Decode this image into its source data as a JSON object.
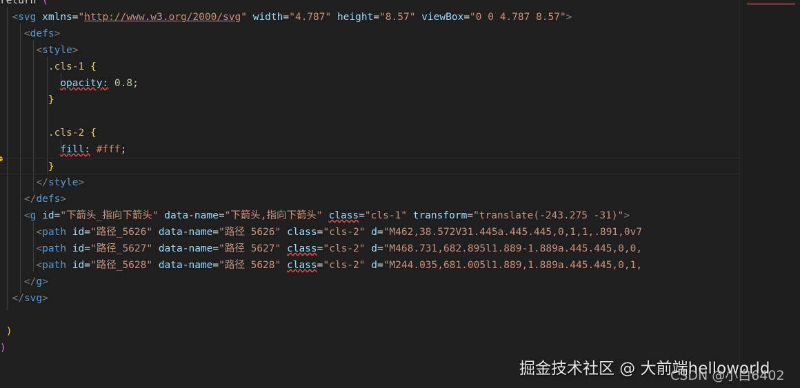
{
  "editor": {
    "lines": [
      [
        [
          "t-txt",
          "return "
        ],
        [
          "t-paren",
          "("
        ]
      ],
      [
        [
          "t-txt",
          "  "
        ],
        [
          "t-br",
          "<"
        ],
        [
          "t-tag",
          "svg"
        ],
        [
          "t-txt",
          " "
        ],
        [
          "t-attr",
          "xmlns"
        ],
        [
          "t-txt",
          "="
        ],
        [
          "t-str",
          "\""
        ],
        [
          "t-url",
          "http://www.w3.org/2000/svg"
        ],
        [
          "t-str",
          "\""
        ],
        [
          "t-txt",
          " "
        ],
        [
          "t-attr",
          "width"
        ],
        [
          "t-txt",
          "="
        ],
        [
          "t-str",
          "\"4.787\""
        ],
        [
          "t-txt",
          " "
        ],
        [
          "t-attr",
          "height"
        ],
        [
          "t-txt",
          "="
        ],
        [
          "t-str",
          "\"8.57\""
        ],
        [
          "t-txt",
          " "
        ],
        [
          "t-attr",
          "viewBox"
        ],
        [
          "t-txt",
          "="
        ],
        [
          "t-str",
          "\"0 0 4.787 8.57\""
        ],
        [
          "t-br",
          ">"
        ]
      ],
      [
        [
          "t-txt",
          "    "
        ],
        [
          "t-br",
          "<"
        ],
        [
          "t-tag",
          "defs"
        ],
        [
          "t-br",
          ">"
        ]
      ],
      [
        [
          "t-txt",
          "      "
        ],
        [
          "t-br",
          "<"
        ],
        [
          "t-tag",
          "style"
        ],
        [
          "t-br",
          ">"
        ]
      ],
      [
        [
          "t-txt",
          "        "
        ],
        [
          "t-sel",
          ".cls-1"
        ],
        [
          "t-txt",
          " "
        ],
        [
          "t-brace",
          "{"
        ]
      ],
      [
        [
          "t-txt",
          "          "
        ],
        [
          "t-prop",
          "opacity:"
        ],
        [
          "t-txt",
          " "
        ],
        [
          "t-num",
          "0.8"
        ],
        [
          "t-txt",
          ";"
        ]
      ],
      [
        [
          "t-txt",
          "        "
        ],
        [
          "t-brace",
          "}"
        ]
      ],
      [
        [
          "t-txt",
          ""
        ]
      ],
      [
        [
          "t-txt",
          "        "
        ],
        [
          "t-sel",
          ".cls-2"
        ],
        [
          "t-txt",
          " "
        ],
        [
          "t-brace",
          "{"
        ]
      ],
      [
        [
          "t-txt",
          "          "
        ],
        [
          "t-prop",
          "fill:"
        ],
        [
          "t-txt",
          " "
        ],
        [
          "t-str",
          "#fff"
        ],
        [
          "t-txt",
          ";"
        ]
      ],
      [
        [
          "t-txt",
          "        "
        ],
        [
          "t-brace",
          "}"
        ]
      ],
      [
        [
          "t-txt",
          "      "
        ],
        [
          "t-br",
          "</"
        ],
        [
          "t-tag",
          "style"
        ],
        [
          "t-br",
          ">"
        ]
      ],
      [
        [
          "t-txt",
          "    "
        ],
        [
          "t-br",
          "</"
        ],
        [
          "t-tag",
          "defs"
        ],
        [
          "t-br",
          ">"
        ]
      ],
      [
        [
          "t-txt",
          "    "
        ],
        [
          "t-br",
          "<"
        ],
        [
          "t-tag",
          "g"
        ],
        [
          "t-txt",
          " "
        ],
        [
          "t-attr",
          "id"
        ],
        [
          "t-txt",
          "="
        ],
        [
          "t-str",
          "\"下箭头_指向下箭头\""
        ],
        [
          "t-txt",
          " "
        ],
        [
          "t-attr",
          "data-name"
        ],
        [
          "t-txt",
          "="
        ],
        [
          "t-str",
          "\"下箭头,指向下箭头\""
        ],
        [
          "t-txt",
          " "
        ],
        [
          "t-attr t-err",
          "class"
        ],
        [
          "t-txt",
          "="
        ],
        [
          "t-str",
          "\"cls-1\""
        ],
        [
          "t-txt",
          " "
        ],
        [
          "t-attr",
          "transform"
        ],
        [
          "t-txt",
          "="
        ],
        [
          "t-str",
          "\"translate(-243.275 -31)\""
        ],
        [
          "t-br",
          ">"
        ]
      ],
      [
        [
          "t-txt",
          "      "
        ],
        [
          "t-br",
          "<"
        ],
        [
          "t-tag",
          "path"
        ],
        [
          "t-txt",
          " "
        ],
        [
          "t-attr",
          "id"
        ],
        [
          "t-txt",
          "="
        ],
        [
          "t-str",
          "\"路径_5626\""
        ],
        [
          "t-txt",
          " "
        ],
        [
          "t-attr",
          "data-name"
        ],
        [
          "t-txt",
          "="
        ],
        [
          "t-str",
          "\"路径 5626\""
        ],
        [
          "t-txt",
          " "
        ],
        [
          "t-attr",
          "class"
        ],
        [
          "t-txt",
          "="
        ],
        [
          "t-str",
          "\"cls-2\""
        ],
        [
          "t-txt",
          " "
        ],
        [
          "t-attr",
          "d"
        ],
        [
          "t-txt",
          "="
        ],
        [
          "t-str",
          "\"M462,38.572V31.445a.445.445,0,1,1,.891,0v7"
        ]
      ],
      [
        [
          "t-txt",
          "      "
        ],
        [
          "t-br",
          "<"
        ],
        [
          "t-tag",
          "path"
        ],
        [
          "t-txt",
          " "
        ],
        [
          "t-attr",
          "id"
        ],
        [
          "t-txt",
          "="
        ],
        [
          "t-str",
          "\"路径_5627\""
        ],
        [
          "t-txt",
          " "
        ],
        [
          "t-attr",
          "data-name"
        ],
        [
          "t-txt",
          "="
        ],
        [
          "t-str",
          "\"路径 5627\""
        ],
        [
          "t-txt",
          " "
        ],
        [
          "t-attr t-err",
          "class"
        ],
        [
          "t-txt",
          "="
        ],
        [
          "t-str",
          "\"cls-2\""
        ],
        [
          "t-txt",
          " "
        ],
        [
          "t-attr",
          "d"
        ],
        [
          "t-txt",
          "="
        ],
        [
          "t-str",
          "\"M468.731,682.895l1.889-1.889a.445.445,0,0,"
        ]
      ],
      [
        [
          "t-txt",
          "      "
        ],
        [
          "t-br",
          "<"
        ],
        [
          "t-tag",
          "path"
        ],
        [
          "t-txt",
          " "
        ],
        [
          "t-attr",
          "id"
        ],
        [
          "t-txt",
          "="
        ],
        [
          "t-str",
          "\"路径_5628\""
        ],
        [
          "t-txt",
          " "
        ],
        [
          "t-attr",
          "data-name"
        ],
        [
          "t-txt",
          "="
        ],
        [
          "t-str",
          "\"路径 5628\""
        ],
        [
          "t-txt",
          " "
        ],
        [
          "t-attr t-err",
          "class"
        ],
        [
          "t-txt",
          "="
        ],
        [
          "t-str",
          "\"cls-2\""
        ],
        [
          "t-txt",
          " "
        ],
        [
          "t-attr",
          "d"
        ],
        [
          "t-txt",
          "="
        ],
        [
          "t-str",
          "\"M244.035,681.005l1.889,1.889a.445.445,0,1,"
        ]
      ],
      [
        [
          "t-txt",
          "    "
        ],
        [
          "t-br",
          "</"
        ],
        [
          "t-tag",
          "g"
        ],
        [
          "t-br",
          ">"
        ]
      ],
      [
        [
          "t-txt",
          "  "
        ],
        [
          "t-br",
          "</"
        ],
        [
          "t-tag",
          "svg"
        ],
        [
          "t-br",
          ">"
        ]
      ],
      [
        [
          "t-txt",
          ""
        ]
      ],
      [
        [
          "t-txt",
          " "
        ],
        [
          "t-brace",
          ")"
        ]
      ],
      [
        [
          "t-paren",
          ")"
        ]
      ]
    ]
  },
  "watermark": {
    "juejin": "掘金技术社区 @ 大前端helloworld",
    "csdn": "CSDN @小白6402"
  }
}
